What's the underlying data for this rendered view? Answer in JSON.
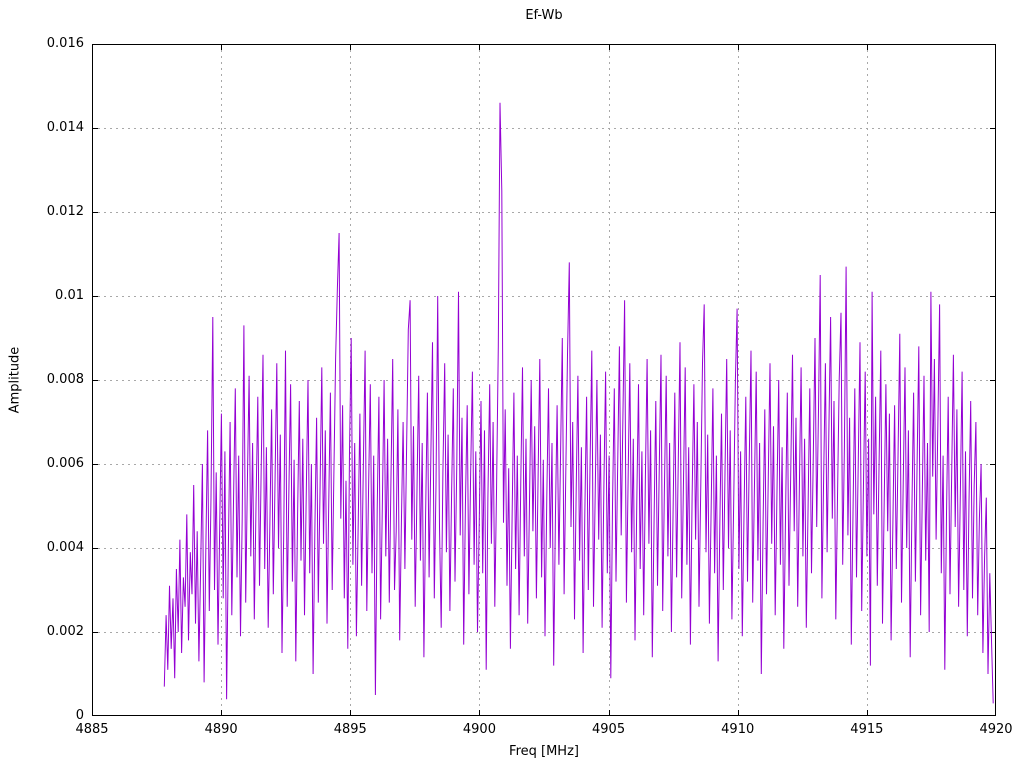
{
  "chart_data": {
    "type": "line",
    "title": "Ef-Wb",
    "xlabel": "Freq [MHz]",
    "ylabel": "Amplitude",
    "xlim": [
      4885,
      4920
    ],
    "ylim": [
      0,
      0.016
    ],
    "grid": true,
    "legend": "none",
    "x_ticks": [
      4885,
      4890,
      4895,
      4900,
      4905,
      4910,
      4915,
      4920
    ],
    "x_tick_labels": [
      "4885",
      "4890",
      "4895",
      "4900",
      "4905",
      "4910",
      "4915",
      "4920"
    ],
    "y_ticks": [
      0,
      0.002,
      0.004,
      0.006,
      0.008,
      0.01,
      0.012,
      0.014,
      0.016
    ],
    "y_tick_labels": [
      "0",
      "0.002",
      "0.004",
      "0.006",
      "0.008",
      "0.01",
      "0.012",
      "0.014",
      "0.016"
    ],
    "series": [
      {
        "name": "Ef-Wb",
        "color": "#9400d3",
        "x_start": 4887.8,
        "x_step": 0.067,
        "amplitude_scale": 0.0001,
        "max_value": 0.0146,
        "max_value_freq": 4900.8,
        "values": [
          7,
          24,
          11,
          31,
          16,
          28,
          9,
          35,
          20,
          42,
          15,
          33,
          26,
          48,
          18,
          39,
          29,
          55,
          22,
          44,
          13,
          36,
          60,
          8,
          41,
          68,
          25,
          52,
          95,
          30,
          58,
          17,
          45,
          72,
          28,
          63,
          4,
          39,
          70,
          24,
          51,
          78,
          33,
          62,
          19,
          47,
          93,
          27,
          56,
          81,
          38,
          65,
          23,
          50,
          76,
          31,
          59,
          86,
          35,
          64,
          21,
          46,
          73,
          29,
          57,
          84,
          40,
          67,
          15,
          43,
          87,
          26,
          54,
          79,
          32,
          61,
          13,
          48,
          75,
          37,
          66,
          24,
          52,
          80,
          34,
          60,
          10,
          45,
          71,
          27,
          55,
          83,
          41,
          68,
          22,
          50,
          77,
          30,
          58,
          85,
          102,
          115,
          47,
          74,
          28,
          56,
          16,
          63,
          90,
          36,
          65,
          19,
          44,
          72,
          31,
          59,
          87,
          25,
          53,
          79,
          34,
          62,
          5,
          49,
          76,
          23,
          51,
          80,
          38,
          66,
          27,
          57,
          85,
          30,
          44,
          73,
          18,
          46,
          70,
          35,
          64,
          92,
          99,
          42,
          69,
          26,
          54,
          81,
          37,
          65,
          14,
          48,
          77,
          33,
          61,
          89,
          28,
          55,
          100,
          45,
          21,
          58,
          84,
          39,
          67,
          25,
          53,
          78,
          32,
          60,
          101,
          43,
          71,
          17,
          50,
          74,
          29,
          57,
          82,
          36,
          63,
          20,
          47,
          75,
          34,
          68,
          11,
          52,
          79,
          41,
          70,
          26,
          55,
          88,
          146,
          125,
          46,
          73,
          31,
          59,
          16,
          49,
          77,
          35,
          62,
          24,
          56,
          83,
          38,
          66,
          22,
          51,
          80,
          44,
          69,
          28,
          57,
          85,
          33,
          61,
          19,
          52,
          78,
          40,
          65,
          12,
          47,
          74,
          36,
          63,
          90,
          29,
          58,
          86,
          108,
          45,
          70,
          23,
          54,
          81,
          37,
          64,
          15,
          48,
          76,
          30,
          59,
          87,
          26,
          53,
          80,
          42,
          67,
          21,
          55,
          82,
          34,
          62,
          9,
          50,
          78,
          32,
          60,
          88,
          43,
          71,
          99,
          27,
          56,
          84,
          39,
          66,
          18,
          51,
          79,
          35,
          63,
          24,
          57,
          85,
          41,
          68,
          14,
          47,
          75,
          31,
          58,
          86,
          25,
          54,
          81,
          38,
          65,
          20,
          49,
          77,
          33,
          61,
          89,
          28,
          56,
          83,
          36,
          64,
          17,
          52,
          79,
          42,
          70,
          26,
          55,
          84,
          98,
          39,
          67,
          22,
          50,
          78,
          34,
          62,
          13,
          45,
          72,
          30,
          58,
          85,
          40,
          68,
          23,
          51,
          80,
          97,
          35,
          63,
          19,
          48,
          76,
          32,
          60,
          87,
          27,
          54,
          82,
          37,
          65,
          10,
          46,
          73,
          29,
          57,
          84,
          41,
          69,
          24,
          52,
          80,
          36,
          64,
          16,
          49,
          77,
          31,
          59,
          86,
          44,
          71,
          26,
          55,
          83,
          38,
          66,
          21,
          50,
          78,
          34,
          62,
          90,
          45,
          73,
          105,
          28,
          56,
          84,
          39,
          67,
          95,
          47,
          75,
          23,
          52,
          80,
          96,
          36,
          64,
          107,
          43,
          71,
          17,
          50,
          78,
          33,
          61,
          89,
          25,
          54,
          82,
          38,
          66,
          12,
          101,
          48,
          76,
          31,
          59,
          87,
          22,
          51,
          79,
          44,
          72,
          18,
          46,
          74,
          35,
          63,
          91,
          27,
          55,
          83,
          40,
          68,
          14,
          49,
          77,
          32,
          60,
          88,
          24,
          53,
          81,
          37,
          65,
          20,
          101,
          57,
          85,
          42,
          70,
          98,
          34,
          62,
          11,
          48,
          76,
          29,
          58,
          86,
          45,
          73,
          26,
          54,
          82,
          30,
          63,
          19,
          51,
          75,
          28,
          55,
          70,
          24,
          47,
          60,
          15,
          38,
          52,
          10,
          34,
          18,
          3
        ]
      }
    ]
  },
  "colors": {
    "trace": "#9400d3",
    "grid": "#a8a8a8",
    "axis": "#000000",
    "text": "#000000",
    "background": "#ffffff"
  }
}
